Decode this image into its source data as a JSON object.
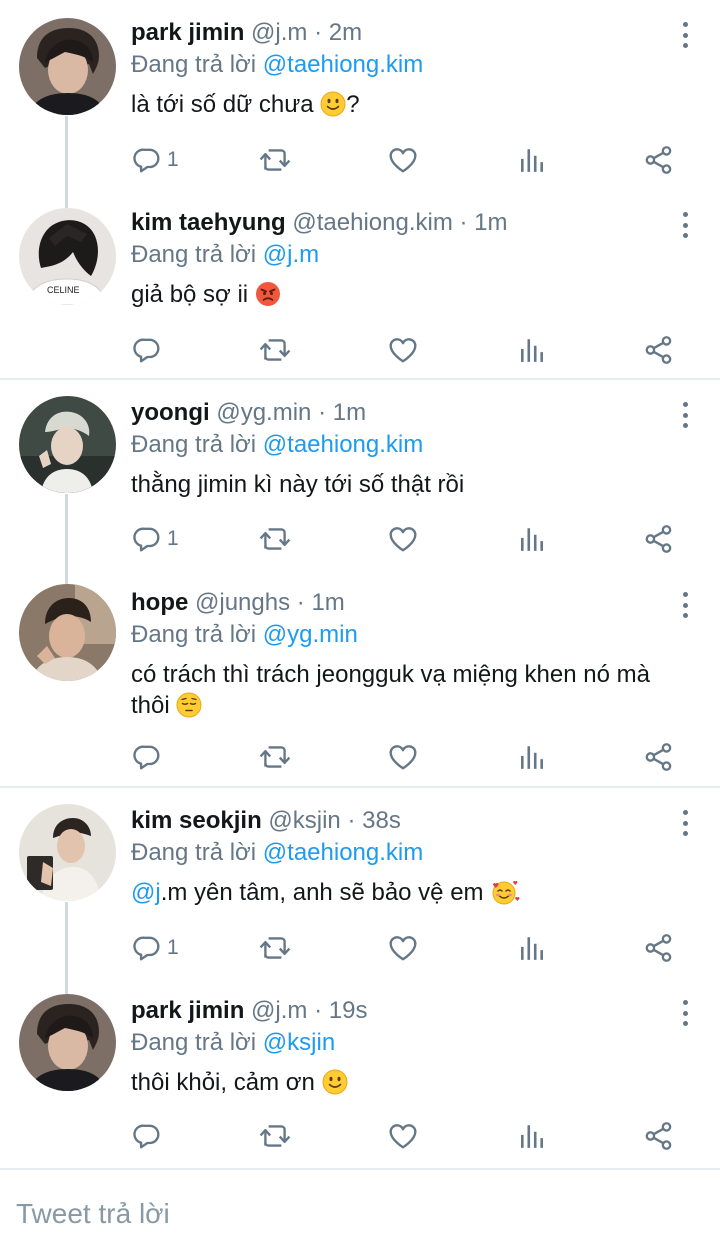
{
  "reply_prefix": "Đang trả lời",
  "tweets": [
    {
      "name": "park jimin",
      "handle": "@j.m",
      "time": "2m",
      "reply_to": "@taehiong.kim",
      "text": "là tới số dữ chưa",
      "emoji": "slightly-smiling-face-icon",
      "emoji_after": "?",
      "reply_count": "1"
    },
    {
      "name": "kim taehyung",
      "handle": "@taehiong.kim",
      "time": "1m",
      "reply_to": "@j.m",
      "text": "giả bộ sợ ii",
      "emoji": "angry-face-icon",
      "reply_count": ""
    },
    {
      "name": "yoongi",
      "handle": "@yg.min",
      "time": "1m",
      "reply_to": "@taehiong.kim",
      "text": "thằng jimin kì này tới số thật rồi",
      "reply_count": "1"
    },
    {
      "name": "hope",
      "handle": "@junghs",
      "time": "1m",
      "reply_to": "@yg.min",
      "text": "có trách thì trách jeongguk vạ miệng khen nó mà thôi",
      "emoji": "pensive-face-icon",
      "reply_count": ""
    },
    {
      "name": "kim seokjin",
      "handle": "@ksjin",
      "time": "38s",
      "reply_to": "@taehiong.kim",
      "text_mention": "@j",
      "text": ".m yên tâm, anh sẽ bảo vệ em",
      "emoji": "smiling-face-with-hearts-icon",
      "reply_count": "1"
    },
    {
      "name": "park jimin",
      "handle": "@j.m",
      "time": "19s",
      "reply_to": "@ksjin",
      "text": "thôi khỏi, cảm ơn",
      "emoji": "slightly-smiling-face-icon",
      "reply_count": ""
    }
  ],
  "reply_box": {
    "placeholder": "Tweet trả lời"
  },
  "colors": {
    "accent": "#1d9bf0",
    "muted": "#657786",
    "text": "#14171a",
    "divider": "#e6ecf0"
  }
}
